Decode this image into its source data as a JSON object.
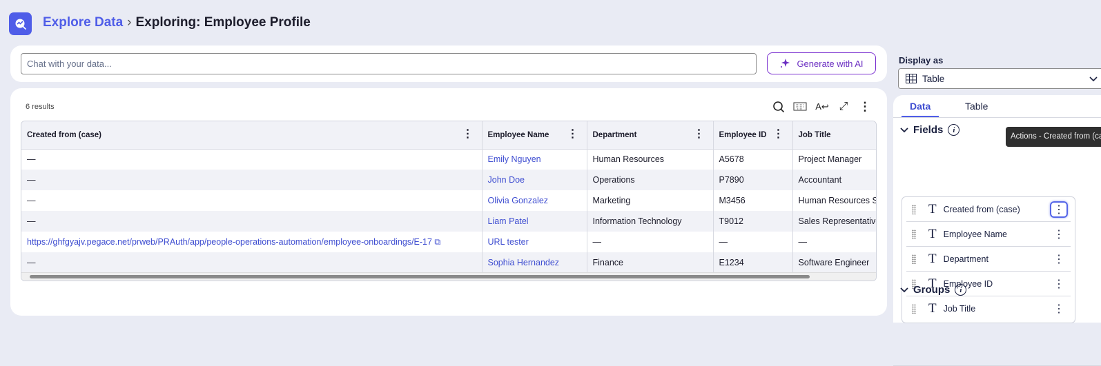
{
  "header": {
    "breadcrumb_link": "Explore Data",
    "title": "Exploring: Employee Profile"
  },
  "chat": {
    "placeholder": "Chat with your data...",
    "generate_label": "Generate with AI"
  },
  "results": {
    "count_label": "6 results"
  },
  "table": {
    "columns": [
      "Created from (case)",
      "Employee Name",
      "Department",
      "Employee ID",
      "Job Title"
    ],
    "rows": [
      [
        "—",
        "Emily Nguyen",
        "Human Resources",
        "A5678",
        "Project Manager"
      ],
      [
        "—",
        "John Doe",
        "Operations",
        "P7890",
        "Accountant"
      ],
      [
        "—",
        "Olivia Gonzalez",
        "Marketing",
        "M3456",
        "Human Resources Specialist"
      ],
      [
        "—",
        "Liam Patel",
        "Information Technology",
        "T9012",
        "Sales Representative"
      ],
      [
        "https://ghfgyajv.pegace.net/prweb/PRAuth/app/people-operations-automation/employee-onboardings/E-17",
        "URL tester",
        "—",
        "—",
        "—"
      ],
      [
        "—",
        "Sophia Hernandez",
        "Finance",
        "E1234",
        "Software Engineer"
      ]
    ]
  },
  "sidebar": {
    "display_as_label": "Display as",
    "display_as_value": "Table",
    "tabs": [
      "Data",
      "Table"
    ],
    "fields_title": "Fields",
    "groups_title": "Groups",
    "fields": [
      "Created from (case)",
      "Employee Name",
      "Department",
      "Employee ID",
      "Job Title"
    ],
    "tooltip": "Actions - Created from (case)"
  },
  "colors": {
    "accent": "#4f5de8",
    "ai": "#6b2ec2",
    "background": "#e9ebf4"
  }
}
